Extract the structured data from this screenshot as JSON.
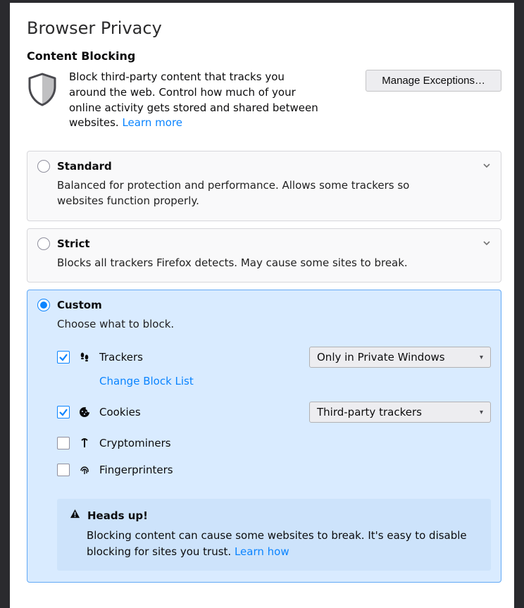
{
  "title": "Browser Privacy",
  "section": "Content Blocking",
  "intro_text": "Block third-party content that tracks you around the web. Control how much of your online activity gets stored and shared between websites.  ",
  "learn_more": "Learn more",
  "manage_exceptions": "Manage Exceptions…",
  "options": {
    "standard": {
      "title": "Standard",
      "desc": "Balanced for protection and performance. Allows some trackers so websites function properly."
    },
    "strict": {
      "title": "Strict",
      "desc": "Blocks all trackers Firefox detects. May cause some sites to break."
    },
    "custom": {
      "title": "Custom",
      "desc": "Choose what to block.",
      "trackers": {
        "label": "Trackers",
        "dropdown": "Only in Private Windows",
        "change_list": "Change Block List",
        "checked": true
      },
      "cookies": {
        "label": "Cookies",
        "dropdown": "Third-party trackers",
        "checked": true
      },
      "cryptominers": {
        "label": "Cryptominers",
        "checked": false
      },
      "fingerprinters": {
        "label": "Fingerprinters",
        "checked": false
      }
    }
  },
  "headsup": {
    "title": "Heads up!",
    "body": "Blocking content can cause some websites to break. It's easy to disable blocking for sites you trust.  ",
    "learn_how": "Learn how"
  }
}
